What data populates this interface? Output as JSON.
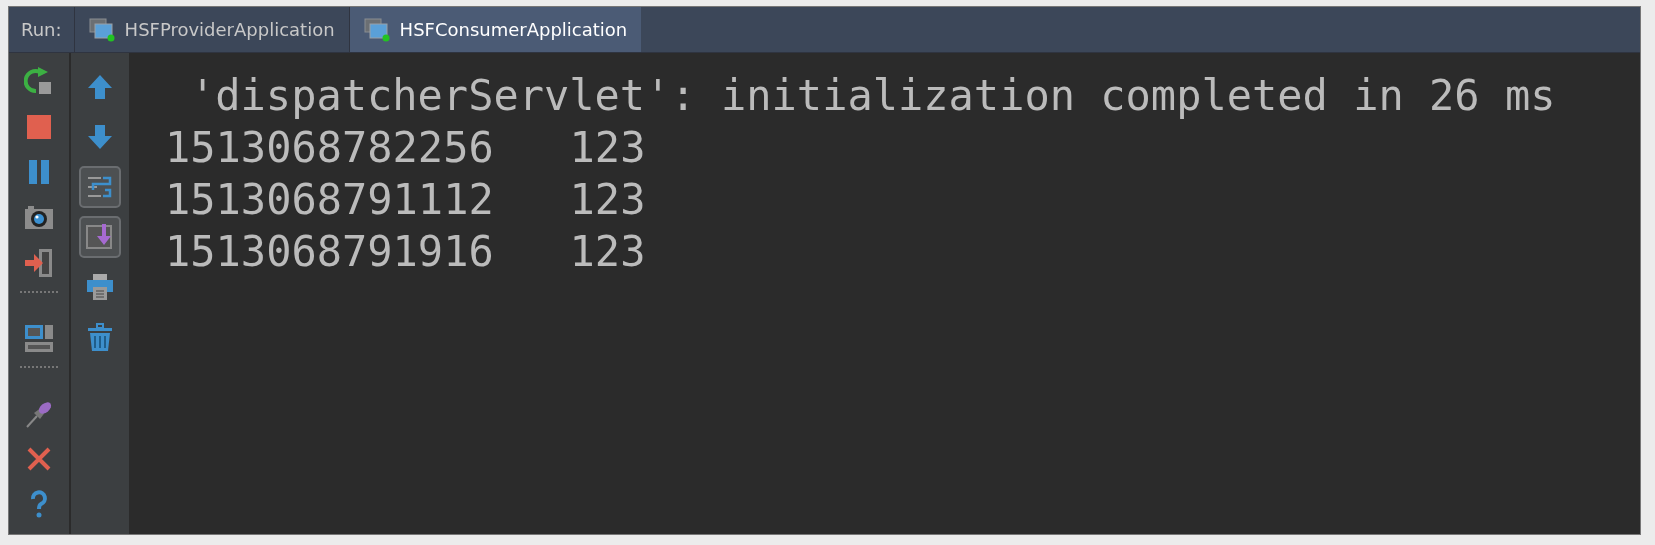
{
  "run_bar": {
    "label": "Run:",
    "tabs": [
      {
        "label": "HSFProviderApplication",
        "selected": false
      },
      {
        "label": "HSFConsumerApplication",
        "selected": true
      }
    ]
  },
  "left_toolbar": [
    {
      "kind": "rerun"
    },
    {
      "kind": "stop"
    },
    {
      "kind": "pause"
    },
    {
      "kind": "camera"
    },
    {
      "kind": "exit"
    },
    {
      "kind": "separator"
    },
    {
      "kind": "layout"
    },
    {
      "kind": "separator"
    },
    {
      "kind": "pin"
    },
    {
      "kind": "close"
    },
    {
      "kind": "help"
    }
  ],
  "right_toolbar": [
    {
      "kind": "up",
      "on": false
    },
    {
      "kind": "down",
      "on": false
    },
    {
      "kind": "wrap",
      "on": true
    },
    {
      "kind": "scroll",
      "on": true
    },
    {
      "kind": "print",
      "on": false
    },
    {
      "kind": "trash",
      "on": false
    }
  ],
  "console": {
    "lines": [
      {
        "text": "'dispatcherServlet': initialization completed in 26 ms",
        "indent": true
      },
      {
        "text": "1513068782256   123",
        "indent": false
      },
      {
        "text": "1513068791112   123",
        "indent": false
      },
      {
        "text": "1513068791916   123",
        "indent": false
      }
    ]
  }
}
